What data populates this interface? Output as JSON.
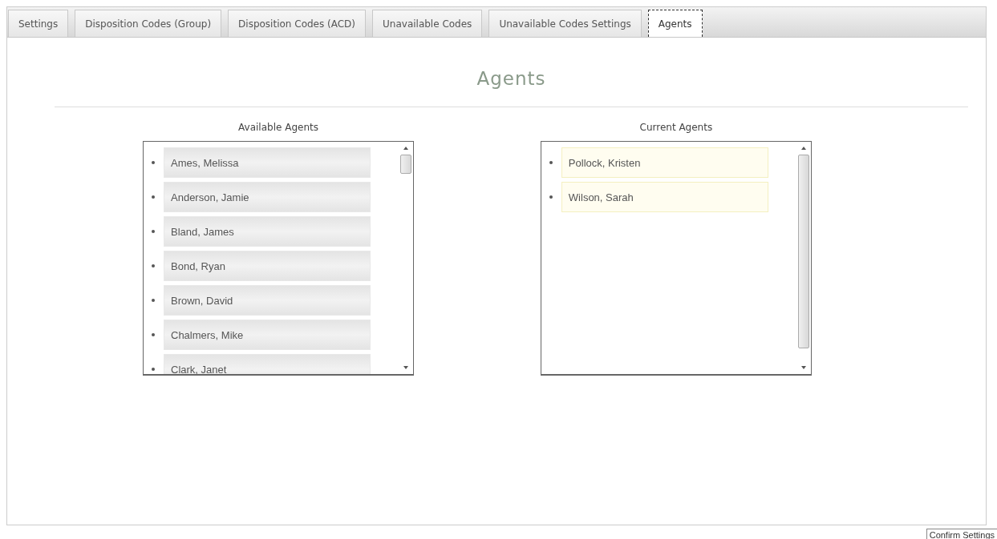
{
  "tabs": [
    {
      "label": "Settings",
      "selected": false
    },
    {
      "label": "Disposition Codes (Group)",
      "selected": false
    },
    {
      "label": "Disposition Codes (ACD)",
      "selected": false
    },
    {
      "label": "Unavailable Codes",
      "selected": false
    },
    {
      "label": "Unavailable Codes Settings",
      "selected": false
    },
    {
      "label": "Agents",
      "selected": true
    }
  ],
  "heading": "Agents",
  "lists": [
    {
      "label": "Available Agents",
      "kind": "available",
      "items": [
        "Ames, Melissa",
        "Anderson, Jamie",
        "Bland, James",
        "Bond, Ryan",
        "Brown, David",
        "Chalmers, Mike",
        "Clark, Janet"
      ]
    },
    {
      "label": "Current Agents",
      "kind": "current",
      "items": [
        "Pollock, Kristen",
        "Wilson, Sarah"
      ]
    }
  ],
  "confirm_button": "Confirm Settings"
}
